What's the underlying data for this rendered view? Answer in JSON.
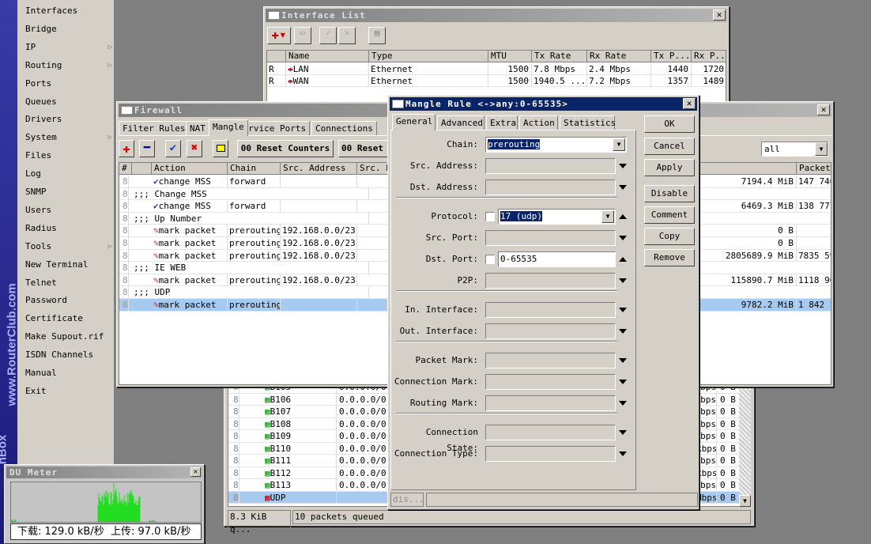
{
  "sidebar": {
    "brand": "www.RouterClub.com",
    "brand2": "nBox",
    "items": [
      {
        "label": "Interfaces",
        "sub": false
      },
      {
        "label": "Bridge",
        "sub": false
      },
      {
        "label": "IP",
        "sub": true
      },
      {
        "label": "Routing",
        "sub": true
      },
      {
        "label": "Ports",
        "sub": false
      },
      {
        "label": "Queues",
        "sub": false
      },
      {
        "label": "Drivers",
        "sub": false
      },
      {
        "label": "System",
        "sub": true
      },
      {
        "label": "Files",
        "sub": false
      },
      {
        "label": "Log",
        "sub": false
      },
      {
        "label": "SNMP",
        "sub": false
      },
      {
        "label": "Users",
        "sub": false
      },
      {
        "label": "Radius",
        "sub": false
      },
      {
        "label": "Tools",
        "sub": true
      },
      {
        "label": "New Terminal",
        "sub": false
      },
      {
        "label": "Telnet",
        "sub": false
      },
      {
        "label": "Password",
        "sub": false
      },
      {
        "label": "Certificate",
        "sub": false
      },
      {
        "label": "Make Supout.rif",
        "sub": false
      },
      {
        "label": "ISDN Channels",
        "sub": false
      },
      {
        "label": "Manual",
        "sub": false
      },
      {
        "label": "Exit",
        "sub": false
      }
    ]
  },
  "interface_list": {
    "title": "Interface List",
    "columns": [
      "",
      "Name",
      "Type",
      "MTU",
      "Tx Rate",
      "Rx Rate",
      "Tx P...",
      "Rx P..."
    ],
    "rows": [
      [
        "R",
        "LAN",
        "Ethernet",
        "1500",
        "7.8 Mbps",
        "2.4 Mbps",
        "1440",
        "1720"
      ],
      [
        "R",
        "WAN",
        "Ethernet",
        "1500",
        "1940.5 ...",
        "7.2 Mbps",
        "1357",
        "1489"
      ]
    ]
  },
  "queue_list": {
    "rows": [
      [
        "B105",
        "0.0.0.0/0",
        "bps",
        "0 B"
      ],
      [
        "B106",
        "0.0.0.0/0",
        "bps",
        "0 B"
      ],
      [
        "B107",
        "0.0.0.0/0",
        "bps",
        "0 B"
      ],
      [
        "B108",
        "0.0.0.0/0",
        "bps",
        "0 B"
      ],
      [
        "B109",
        "0.0.0.0/0",
        "bps",
        "0 B"
      ],
      [
        "B110",
        "0.0.0.0/0",
        "kbps",
        "0 B"
      ],
      [
        "B111",
        "0.0.0.0/0",
        "bps",
        "0 B"
      ],
      [
        "B112",
        "0.0.0.0/0",
        "kbps",
        "0 B"
      ],
      [
        "B113",
        "0.0.0.0/0",
        "bps",
        "0 B"
      ],
      [
        "UDP",
        "",
        "Mbps",
        "0 B"
      ]
    ],
    "status": [
      "8.3 KiB q...",
      "10 packets queued"
    ]
  },
  "firewall": {
    "title": "Firewall",
    "tabs": [
      "Filter Rules",
      "NAT",
      "Mangle",
      "Service Ports",
      "Connections"
    ],
    "active_tab": "Mangle",
    "toolbar": {
      "reset_counters": "00 Reset Counters",
      "reset_all": "00 Reset"
    },
    "filter": "all",
    "columns": [
      "#",
      "",
      "Action",
      "Chain",
      "Src. Address",
      "Src. P",
      "ytes",
      "Packets"
    ],
    "rows": [
      {
        "type": "rule",
        "icon": "check",
        "action": "change MSS",
        "chain": "forward",
        "src": "",
        "bytes": "7194.4 MiB",
        "packets": "147 746"
      },
      {
        "type": "comment",
        "text": ";;; Change MSS"
      },
      {
        "type": "rule",
        "icon": "check",
        "action": "change MSS",
        "chain": "forward",
        "src": "",
        "bytes": "6469.3 MiB",
        "packets": "138 777"
      },
      {
        "type": "comment",
        "text": ";;; Up Number"
      },
      {
        "type": "rule",
        "icon": "pencil",
        "action": "mark packet",
        "chain": "prerouting",
        "src": "192.168.0.0/23",
        "bytes": "0 B",
        "packets": ""
      },
      {
        "type": "rule",
        "icon": "pencil",
        "action": "mark packet",
        "chain": "prerouting",
        "src": "192.168.0.0/23",
        "bytes": "0 B",
        "packets": ""
      },
      {
        "type": "rule",
        "icon": "pencil",
        "action": "mark packet",
        "chain": "prerouting",
        "src": "192.168.0.0/23",
        "bytes": "2805689.9 MiB",
        "packets": "7835 59"
      },
      {
        "type": "comment",
        "text": ";;; IE WEB"
      },
      {
        "type": "rule",
        "icon": "pencil",
        "action": "mark packet",
        "chain": "prerouting",
        "src": "192.168.0.0/23",
        "bytes": "115890.7 MiB",
        "packets": "1118 90"
      },
      {
        "type": "comment",
        "text": ";;; UDP"
      },
      {
        "type": "rule",
        "icon": "pencil",
        "action": "mark packet",
        "chain": "prerouting",
        "src": "",
        "bytes": "9782.2 MiB",
        "packets": "1 842",
        "selected": true
      }
    ]
  },
  "mangle_rule": {
    "title": "Mangle Rule <->any:0-65535>",
    "tabs": [
      "General",
      "Advanced",
      "Extra",
      "Action",
      "Statistics"
    ],
    "active_tab": "General",
    "buttons": [
      "OK",
      "Cancel",
      "Apply",
      "Disable",
      "Comment",
      "Copy",
      "Remove"
    ],
    "fields": [
      {
        "label": "Chain:",
        "value": "prerouting",
        "kind": "select",
        "selected": true
      },
      {
        "label": "Src. Address:",
        "value": "",
        "kind": "empty"
      },
      {
        "label": "Dst. Address:",
        "value": "",
        "kind": "empty",
        "sep_after": true
      },
      {
        "label": "Protocol:",
        "value": "17 (udp)",
        "kind": "select-check",
        "selected": true
      },
      {
        "label": "Src. Port:",
        "value": "",
        "kind": "empty"
      },
      {
        "label": "Dst. Port:",
        "value": "0-65535",
        "kind": "text-check"
      },
      {
        "label": "P2P:",
        "value": "",
        "kind": "empty",
        "sep_after": true
      },
      {
        "label": "In. Interface:",
        "value": "",
        "kind": "empty"
      },
      {
        "label": "Out. Interface:",
        "value": "",
        "kind": "empty",
        "sep_after": true
      },
      {
        "label": "Packet Mark:",
        "value": "",
        "kind": "empty"
      },
      {
        "label": "Connection Mark:",
        "value": "",
        "kind": "empty"
      },
      {
        "label": "Routing Mark:",
        "value": "",
        "kind": "empty",
        "sep_after": true
      },
      {
        "label": "Connection State:",
        "value": "",
        "kind": "empty"
      },
      {
        "label": "Connection Type:",
        "value": "",
        "kind": "empty"
      }
    ],
    "status": "dis..."
  },
  "du_meter": {
    "title": "DU Meter",
    "download": "下载: 129.0 kB/秒",
    "upload": "上传: 97.0 kB/秒",
    "graph_color": "#22dd22"
  }
}
